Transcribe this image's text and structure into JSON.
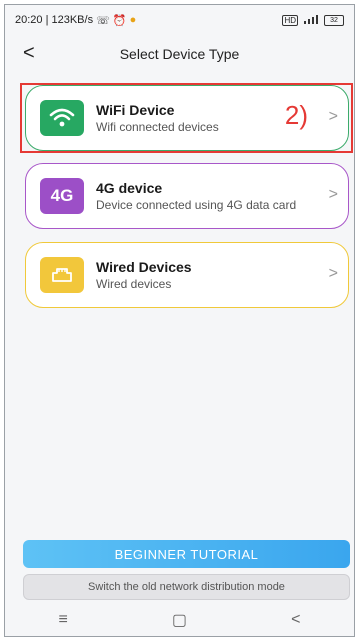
{
  "status": {
    "time_speed": "20:20 | 123KB/s",
    "battery": "32"
  },
  "header": {
    "back_glyph": "<",
    "title": "Select Device Type"
  },
  "devices": [
    {
      "title": "WiFi Device",
      "subtitle": "Wifi connected devices",
      "icon": "wifi-icon",
      "color": "#27a862"
    },
    {
      "title": "4G device",
      "subtitle": "Device connected using 4G data card",
      "icon": "4g-icon",
      "icon_label": "4G",
      "color": "#9c4fc7"
    },
    {
      "title": "Wired Devices",
      "subtitle": "Wired devices",
      "icon": "ethernet-port-icon",
      "color": "#f2c73b"
    }
  ],
  "annotation": "2)",
  "chevron": ">",
  "buttons": {
    "tutorial": "BEGINNER TUTORIAL",
    "switch_mode": "Switch the old network distribution mode"
  },
  "system_nav": {
    "menu": "≡",
    "home": "▢",
    "back": "<"
  }
}
